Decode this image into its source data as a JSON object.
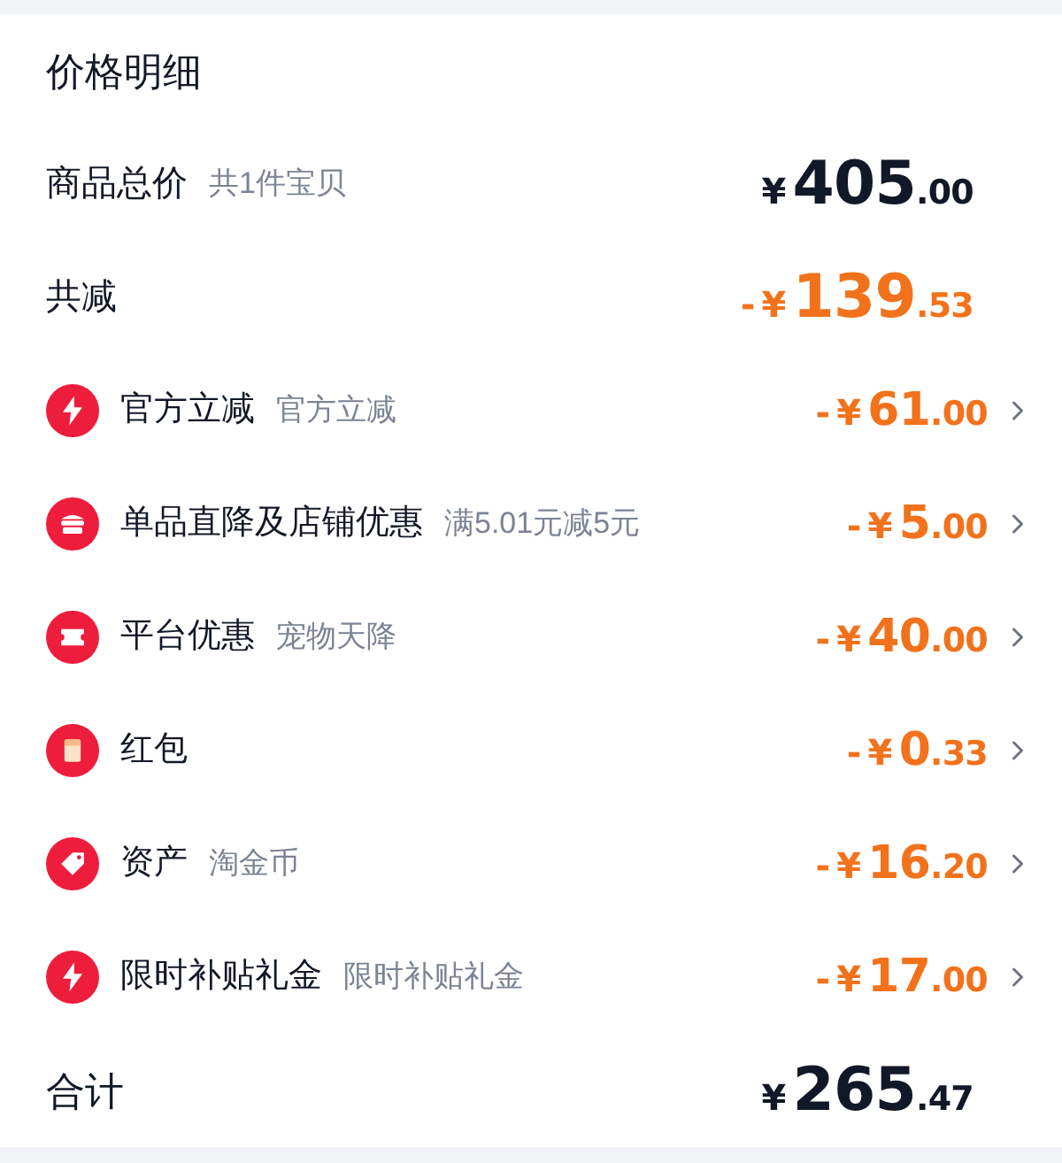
{
  "title": "价格明细",
  "subtotal": {
    "label": "商品总价",
    "note": "共1件宝贝",
    "price": {
      "currency": "¥",
      "integer": "405",
      "decimal": ".00"
    }
  },
  "total_discount": {
    "label": "共减",
    "price": {
      "sign": "-",
      "currency": "¥",
      "integer": "139",
      "decimal": ".53"
    }
  },
  "discounts": [
    {
      "kind": "bolt",
      "label": "官方立减",
      "note": "官方立减",
      "price": {
        "sign": "-",
        "currency": "¥",
        "integer": "61",
        "decimal": ".00"
      }
    },
    {
      "kind": "shop",
      "label": "单品直降及店铺优惠",
      "note": "满5.01元减5元",
      "price": {
        "sign": "-",
        "currency": "¥",
        "integer": "5",
        "decimal": ".00"
      }
    },
    {
      "kind": "ticket",
      "label": "平台优惠",
      "note": "宠物天降",
      "price": {
        "sign": "-",
        "currency": "¥",
        "integer": "40",
        "decimal": ".00"
      }
    },
    {
      "kind": "envelope",
      "label": "红包",
      "price": {
        "sign": "-",
        "currency": "¥",
        "integer": "0",
        "decimal": ".33"
      }
    },
    {
      "kind": "tag",
      "label": "资产",
      "note": "淘金币",
      "price": {
        "sign": "-",
        "currency": "¥",
        "integer": "16",
        "decimal": ".20"
      }
    },
    {
      "kind": "bolt",
      "label": "限时补贴礼金",
      "note": "限时补贴礼金",
      "price": {
        "sign": "-",
        "currency": "¥",
        "integer": "17",
        "decimal": ".00"
      }
    }
  ],
  "total": {
    "label": "合计",
    "price": {
      "currency": "¥",
      "integer": "265",
      "decimal": ".47"
    }
  }
}
